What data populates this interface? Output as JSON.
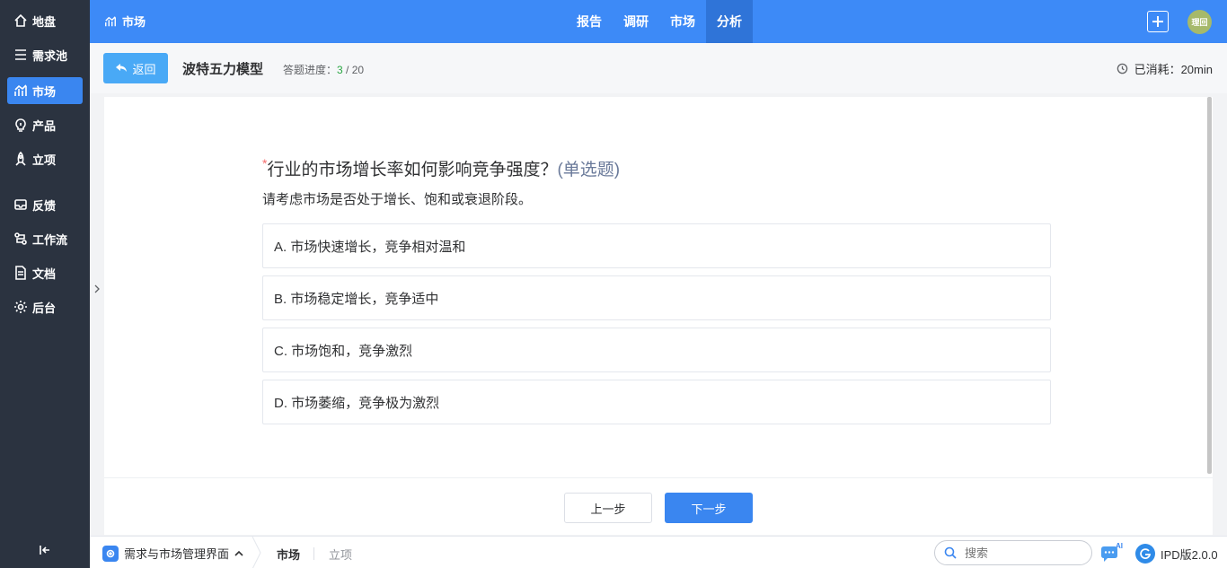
{
  "sidebar": {
    "items": [
      {
        "label": "地盘",
        "icon": "home-icon"
      },
      {
        "label": "需求池",
        "icon": "list-icon"
      },
      {
        "label": "市场",
        "icon": "chart-icon",
        "active": true
      },
      {
        "label": "产品",
        "icon": "bulb-icon"
      },
      {
        "label": "立项",
        "icon": "rocket-icon"
      },
      {
        "label": "反馈",
        "icon": "inbox-icon"
      },
      {
        "label": "工作流",
        "icon": "workflow-icon"
      },
      {
        "label": "文档",
        "icon": "document-icon"
      },
      {
        "label": "后台",
        "icon": "gear-icon"
      }
    ]
  },
  "topbar": {
    "crumb": "市场",
    "nav": [
      "报告",
      "调研",
      "市场",
      "分析"
    ],
    "active_nav": "分析",
    "avatar_text": "理回"
  },
  "header": {
    "back_label": "返回",
    "title": "波特五力模型",
    "progress_label": "答题进度：",
    "progress_current": "3",
    "progress_total": " / 20",
    "elapsed": "已消耗：20min"
  },
  "question": {
    "required_mark": "*",
    "title": "行业的市场增长率如何影响竞争强度？",
    "type": "(单选题)",
    "description": "请考虑市场是否处于增长、饱和或衰退阶段。",
    "options": [
      "A. 市场快速增长，竞争相对温和",
      "B. 市场稳定增长，竞争适中",
      "C. 市场饱和，竞争激烈",
      "D. 市场萎缩，竞争极为激烈"
    ]
  },
  "footer": {
    "prev_label": "上一步",
    "next_label": "下一步"
  },
  "bottombar": {
    "app_name": "需求与市场管理界面",
    "tabs": [
      "市场",
      "立项"
    ],
    "search_placeholder": "搜索",
    "ai_label": "AI",
    "version": "IPD版2.0.0"
  },
  "colors": {
    "accent": "#3a86f0",
    "topbar": "#3d8af7",
    "sidebar": "#2b3340",
    "progress": "#2aa744",
    "required": "#f56c6c"
  }
}
